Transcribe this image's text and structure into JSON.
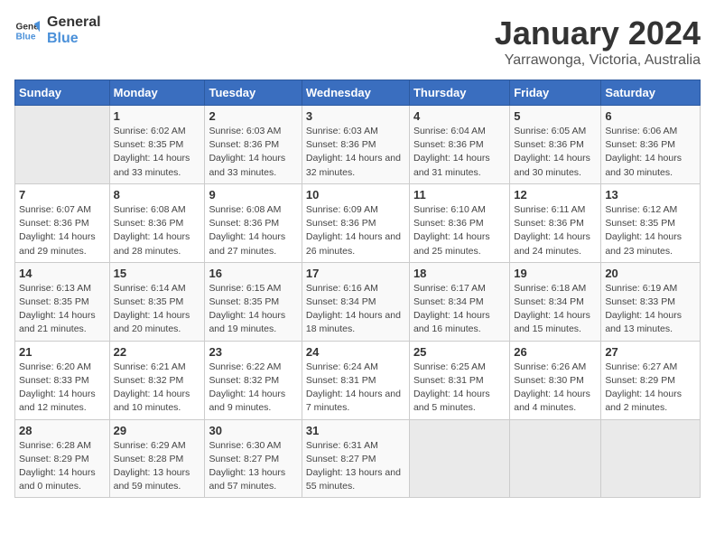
{
  "header": {
    "logo_line1": "General",
    "logo_line2": "Blue",
    "title": "January 2024",
    "subtitle": "Yarrawonga, Victoria, Australia"
  },
  "columns": [
    "Sunday",
    "Monday",
    "Tuesday",
    "Wednesday",
    "Thursday",
    "Friday",
    "Saturday"
  ],
  "weeks": [
    [
      {
        "day": "",
        "sunrise": "",
        "sunset": "",
        "daylight": ""
      },
      {
        "day": "1",
        "sunrise": "Sunrise: 6:02 AM",
        "sunset": "Sunset: 8:35 PM",
        "daylight": "Daylight: 14 hours and 33 minutes."
      },
      {
        "day": "2",
        "sunrise": "Sunrise: 6:03 AM",
        "sunset": "Sunset: 8:36 PM",
        "daylight": "Daylight: 14 hours and 33 minutes."
      },
      {
        "day": "3",
        "sunrise": "Sunrise: 6:03 AM",
        "sunset": "Sunset: 8:36 PM",
        "daylight": "Daylight: 14 hours and 32 minutes."
      },
      {
        "day": "4",
        "sunrise": "Sunrise: 6:04 AM",
        "sunset": "Sunset: 8:36 PM",
        "daylight": "Daylight: 14 hours and 31 minutes."
      },
      {
        "day": "5",
        "sunrise": "Sunrise: 6:05 AM",
        "sunset": "Sunset: 8:36 PM",
        "daylight": "Daylight: 14 hours and 30 minutes."
      },
      {
        "day": "6",
        "sunrise": "Sunrise: 6:06 AM",
        "sunset": "Sunset: 8:36 PM",
        "daylight": "Daylight: 14 hours and 30 minutes."
      }
    ],
    [
      {
        "day": "7",
        "sunrise": "Sunrise: 6:07 AM",
        "sunset": "Sunset: 8:36 PM",
        "daylight": "Daylight: 14 hours and 29 minutes."
      },
      {
        "day": "8",
        "sunrise": "Sunrise: 6:08 AM",
        "sunset": "Sunset: 8:36 PM",
        "daylight": "Daylight: 14 hours and 28 minutes."
      },
      {
        "day": "9",
        "sunrise": "Sunrise: 6:08 AM",
        "sunset": "Sunset: 8:36 PM",
        "daylight": "Daylight: 14 hours and 27 minutes."
      },
      {
        "day": "10",
        "sunrise": "Sunrise: 6:09 AM",
        "sunset": "Sunset: 8:36 PM",
        "daylight": "Daylight: 14 hours and 26 minutes."
      },
      {
        "day": "11",
        "sunrise": "Sunrise: 6:10 AM",
        "sunset": "Sunset: 8:36 PM",
        "daylight": "Daylight: 14 hours and 25 minutes."
      },
      {
        "day": "12",
        "sunrise": "Sunrise: 6:11 AM",
        "sunset": "Sunset: 8:36 PM",
        "daylight": "Daylight: 14 hours and 24 minutes."
      },
      {
        "day": "13",
        "sunrise": "Sunrise: 6:12 AM",
        "sunset": "Sunset: 8:35 PM",
        "daylight": "Daylight: 14 hours and 23 minutes."
      }
    ],
    [
      {
        "day": "14",
        "sunrise": "Sunrise: 6:13 AM",
        "sunset": "Sunset: 8:35 PM",
        "daylight": "Daylight: 14 hours and 21 minutes."
      },
      {
        "day": "15",
        "sunrise": "Sunrise: 6:14 AM",
        "sunset": "Sunset: 8:35 PM",
        "daylight": "Daylight: 14 hours and 20 minutes."
      },
      {
        "day": "16",
        "sunrise": "Sunrise: 6:15 AM",
        "sunset": "Sunset: 8:35 PM",
        "daylight": "Daylight: 14 hours and 19 minutes."
      },
      {
        "day": "17",
        "sunrise": "Sunrise: 6:16 AM",
        "sunset": "Sunset: 8:34 PM",
        "daylight": "Daylight: 14 hours and 18 minutes."
      },
      {
        "day": "18",
        "sunrise": "Sunrise: 6:17 AM",
        "sunset": "Sunset: 8:34 PM",
        "daylight": "Daylight: 14 hours and 16 minutes."
      },
      {
        "day": "19",
        "sunrise": "Sunrise: 6:18 AM",
        "sunset": "Sunset: 8:34 PM",
        "daylight": "Daylight: 14 hours and 15 minutes."
      },
      {
        "day": "20",
        "sunrise": "Sunrise: 6:19 AM",
        "sunset": "Sunset: 8:33 PM",
        "daylight": "Daylight: 14 hours and 13 minutes."
      }
    ],
    [
      {
        "day": "21",
        "sunrise": "Sunrise: 6:20 AM",
        "sunset": "Sunset: 8:33 PM",
        "daylight": "Daylight: 14 hours and 12 minutes."
      },
      {
        "day": "22",
        "sunrise": "Sunrise: 6:21 AM",
        "sunset": "Sunset: 8:32 PM",
        "daylight": "Daylight: 14 hours and 10 minutes."
      },
      {
        "day": "23",
        "sunrise": "Sunrise: 6:22 AM",
        "sunset": "Sunset: 8:32 PM",
        "daylight": "Daylight: 14 hours and 9 minutes."
      },
      {
        "day": "24",
        "sunrise": "Sunrise: 6:24 AM",
        "sunset": "Sunset: 8:31 PM",
        "daylight": "Daylight: 14 hours and 7 minutes."
      },
      {
        "day": "25",
        "sunrise": "Sunrise: 6:25 AM",
        "sunset": "Sunset: 8:31 PM",
        "daylight": "Daylight: 14 hours and 5 minutes."
      },
      {
        "day": "26",
        "sunrise": "Sunrise: 6:26 AM",
        "sunset": "Sunset: 8:30 PM",
        "daylight": "Daylight: 14 hours and 4 minutes."
      },
      {
        "day": "27",
        "sunrise": "Sunrise: 6:27 AM",
        "sunset": "Sunset: 8:29 PM",
        "daylight": "Daylight: 14 hours and 2 minutes."
      }
    ],
    [
      {
        "day": "28",
        "sunrise": "Sunrise: 6:28 AM",
        "sunset": "Sunset: 8:29 PM",
        "daylight": "Daylight: 14 hours and 0 minutes."
      },
      {
        "day": "29",
        "sunrise": "Sunrise: 6:29 AM",
        "sunset": "Sunset: 8:28 PM",
        "daylight": "Daylight: 13 hours and 59 minutes."
      },
      {
        "day": "30",
        "sunrise": "Sunrise: 6:30 AM",
        "sunset": "Sunset: 8:27 PM",
        "daylight": "Daylight: 13 hours and 57 minutes."
      },
      {
        "day": "31",
        "sunrise": "Sunrise: 6:31 AM",
        "sunset": "Sunset: 8:27 PM",
        "daylight": "Daylight: 13 hours and 55 minutes."
      },
      {
        "day": "",
        "sunrise": "",
        "sunset": "",
        "daylight": ""
      },
      {
        "day": "",
        "sunrise": "",
        "sunset": "",
        "daylight": ""
      },
      {
        "day": "",
        "sunrise": "",
        "sunset": "",
        "daylight": ""
      }
    ]
  ]
}
